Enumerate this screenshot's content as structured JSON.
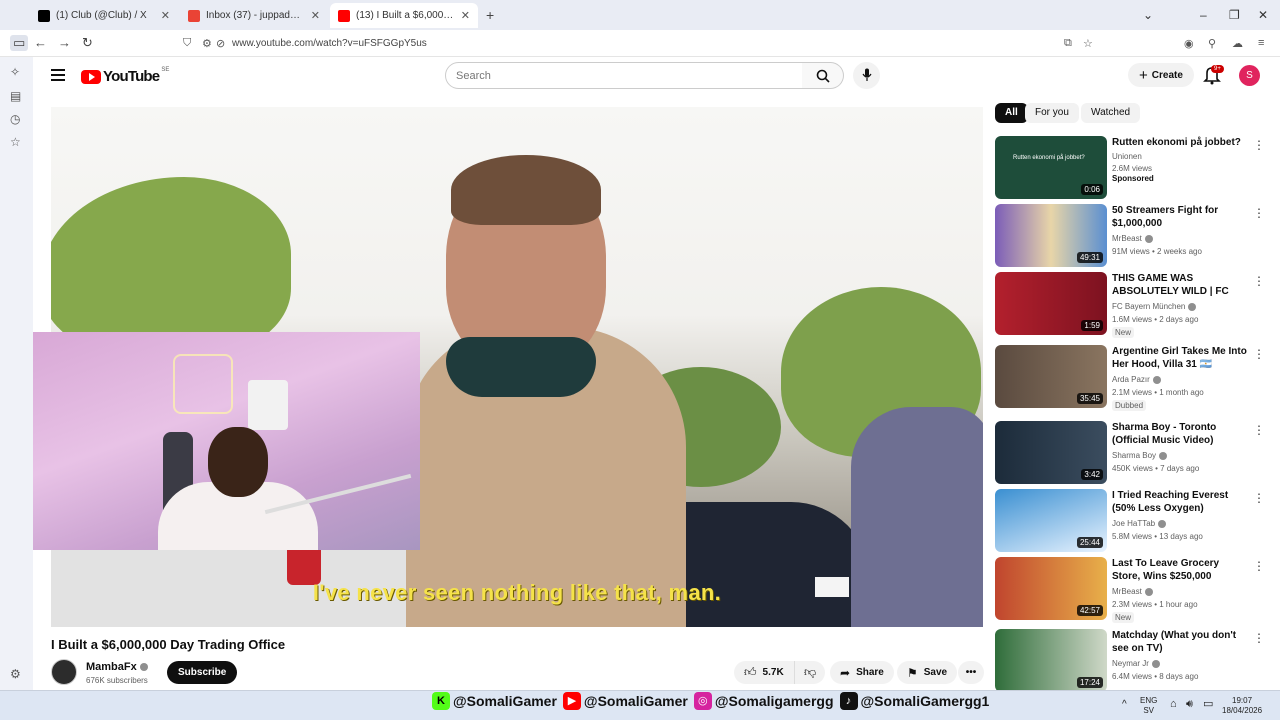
{
  "browser": {
    "tabs": [
      {
        "title": "(1) Club (@Club) / X",
        "icon": "x-logo-icon",
        "color": "#000000"
      },
      {
        "title": "Inbox (37) - juppadzeko77@gm",
        "icon": "gmail-icon",
        "color": "#ea4335"
      },
      {
        "title": "(13) I Built a $6,000,000 Day",
        "icon": "youtube-icon",
        "color": "#ff0000"
      }
    ],
    "new_tab": "+",
    "url": "www.youtube.com/watch?v=uFSFGGpY5us"
  },
  "youtube": {
    "region": "SE",
    "logo_text": "YouTube",
    "search_placeholder": "Search",
    "create_label": "Create",
    "notifications_badge": "9+",
    "avatar_letter": "S"
  },
  "player": {
    "caption": "I've never seen nothing like that, man."
  },
  "video": {
    "title": "I Built a $6,000,000 Day Trading Office",
    "channel": "MambaFx",
    "subscribers": "676K subscribers",
    "subscribe_label": "Subscribe",
    "likes": "5.7K",
    "share_label": "Share",
    "save_label": "Save"
  },
  "chips": [
    "All",
    "For you",
    "Watched"
  ],
  "recommendations": [
    {
      "title": "Rutten ekonomi på jobbet?",
      "channel": "Unionen",
      "meta": "2.6M views",
      "tag": "Sponsored",
      "duration": "0:06",
      "thumb": "#1e4d3a",
      "verified": false,
      "thumb_text": "Rutten ekonomi på jobbet?"
    },
    {
      "title": "50 Streamers Fight for $1,000,000",
      "channel": "MrBeast",
      "meta": "91M views • 2 weeks ago",
      "tag": "",
      "duration": "49:31",
      "thumb": "#7b5db8",
      "verified": true
    },
    {
      "title": "THIS GAME WAS ABSOLUTELY WILD | FC Bayern - Real Madri...",
      "channel": "FC Bayern München",
      "meta": "1.6M views • 2 days ago",
      "tag": "New",
      "duration": "1:59",
      "thumb": "#b3202d",
      "verified": true
    },
    {
      "title": "Argentine Girl Takes Me Into Her Hood, Villa 31 🇦🇷",
      "channel": "Arda Pazır",
      "meta": "2.1M views • 1 month ago",
      "tag": "Dubbed",
      "duration": "35:45",
      "thumb": "#5a4a3f",
      "verified": true
    },
    {
      "title": "Sharma Boy - Toronto (Official Music Video)",
      "channel": "Sharma Boy",
      "meta": "450K views • 7 days ago",
      "tag": "",
      "duration": "3:42",
      "thumb": "#1c2b3a",
      "verified": true
    },
    {
      "title": "I Tried Reaching Everest (50% Less Oxygen)",
      "channel": "Joe HaTTab",
      "meta": "5.8M views • 13 days ago",
      "tag": "",
      "duration": "25:44",
      "thumb": "#3a8fd1",
      "verified": true
    },
    {
      "title": "Last To Leave Grocery Store, Wins $250,000",
      "channel": "MrBeast",
      "meta": "2.3M views • 1 hour ago",
      "tag": "New",
      "duration": "42:57",
      "thumb": "#c0452e",
      "verified": true
    },
    {
      "title": "Matchday (What you don't see on TV)",
      "channel": "Neymar Jr",
      "meta": "6.4M views • 8 days ago",
      "tag": "",
      "duration": "17:24",
      "thumb": "#2f6d3a",
      "verified": true
    }
  ],
  "taskbar": {
    "socials": [
      {
        "icon": "kick-icon",
        "handle": "@SomaliGamer",
        "color": "#53fc18",
        "glyph": "K"
      },
      {
        "icon": "youtube-icon",
        "handle": "@SomaliGamer",
        "color": "#ff0000",
        "glyph": "▶"
      },
      {
        "icon": "instagram-icon",
        "handle": "@Somaligamergg",
        "color": "#d6249f",
        "glyph": "◎"
      },
      {
        "icon": "tiktok-icon",
        "handle": "@SomaliGamergg1",
        "color": "#111111",
        "glyph": "♪"
      }
    ],
    "lang": "ENG",
    "lang_sub": "SV",
    "time": "19:07",
    "date": "18/04/2026"
  }
}
